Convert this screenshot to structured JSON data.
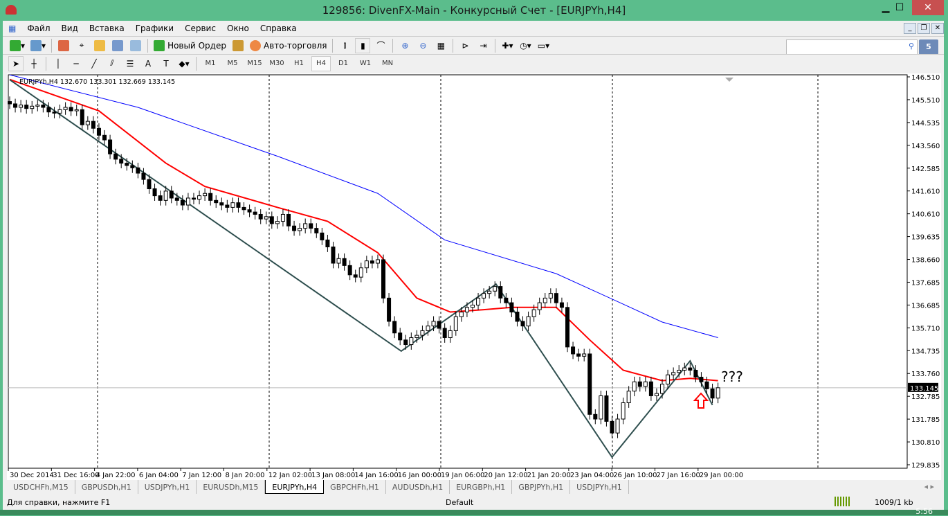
{
  "window": {
    "title": "129856: DivenFX-Main - Конкурсный Счет - [EURJPYh,H4]"
  },
  "menu": [
    "Файл",
    "Вид",
    "Вставка",
    "Графики",
    "Сервис",
    "Окно",
    "Справка"
  ],
  "toolbar": {
    "new_order": "Новый Ордер",
    "auto_trading": "Авто-торговля",
    "messages_count": "5",
    "search_placeholder": ""
  },
  "timeframes": [
    "M1",
    "M5",
    "M15",
    "M30",
    "H1",
    "H4",
    "D1",
    "W1",
    "MN"
  ],
  "active_timeframe": "H4",
  "chart_data": {
    "type": "candlestick",
    "symbol_header": "EURJPYh,H4  132.670 133.301 132.669 133.145",
    "current_price": "133.145",
    "annotation": "???",
    "price_ticks": [
      "146.510",
      "145.510",
      "144.535",
      "143.560",
      "142.585",
      "141.610",
      "140.610",
      "139.635",
      "138.660",
      "137.685",
      "136.685",
      "135.710",
      "134.735",
      "133.760",
      "132.785",
      "131.785",
      "130.810",
      "129.835"
    ],
    "ylim": [
      129.835,
      146.51
    ],
    "time_labels": [
      "30 Dec 2014",
      "31 Dec 16:00",
      "4 Jan 22:00",
      "6 Jan 04:00",
      "7 Jan 12:00",
      "8 Jan 20:00",
      "12 Jan 02:00",
      "13 Jan 08:00",
      "14 Jan 16:00",
      "16 Jan 00:00",
      "19 Jan 06:00",
      "20 Jan 12:00",
      "21 Jan 20:00",
      "23 Jan 04:00",
      "26 Jan 10:00",
      "27 Jan 16:00",
      "29 Jan 00:00"
    ],
    "closes": [
      145.35,
      145.2,
      145.3,
      145.15,
      145.25,
      145.3,
      145.2,
      145.0,
      144.95,
      145.1,
      145.2,
      145.05,
      145.1,
      144.45,
      144.6,
      144.3,
      144.0,
      143.8,
      143.2,
      142.97,
      142.8,
      142.7,
      142.6,
      142.37,
      142.1,
      141.7,
      141.4,
      141.2,
      141.6,
      141.3,
      141.2,
      141.0,
      141.3,
      141.25,
      141.4,
      141.5,
      141.2,
      141.1,
      141.0,
      140.9,
      141.1,
      140.9,
      140.8,
      140.7,
      140.6,
      140.4,
      140.5,
      140.2,
      140.3,
      140.6,
      140.1,
      139.9,
      140.0,
      140.2,
      140.0,
      139.8,
      139.5,
      139.2,
      138.5,
      138.7,
      138.4,
      138.0,
      137.9,
      138.3,
      138.6,
      138.5,
      138.65,
      137.0,
      136.0,
      135.5,
      135.2,
      135.0,
      135.3,
      135.4,
      135.6,
      135.8,
      136.0,
      135.7,
      135.3,
      135.6,
      136.2,
      136.4,
      136.6,
      136.7,
      137.0,
      137.2,
      137.3,
      137.5,
      137.0,
      136.8,
      136.4,
      136.0,
      135.8,
      136.2,
      136.5,
      136.8,
      137.0,
      137.2,
      136.8,
      136.6,
      134.9,
      134.6,
      134.5,
      134.6,
      132.0,
      131.8,
      132.8,
      131.7,
      131.2,
      131.8,
      132.5,
      133.0,
      133.4,
      133.2,
      133.4,
      132.8,
      132.9,
      133.3,
      133.7,
      133.8,
      133.9,
      134.0,
      133.9,
      133.6,
      133.4,
      133.1,
      132.7,
      133.145
    ],
    "ma_red": [
      [
        0,
        146.4
      ],
      [
        16,
        145.05
      ],
      [
        28,
        142.8
      ],
      [
        35,
        141.8
      ],
      [
        48,
        140.9
      ],
      [
        57,
        140.3
      ],
      [
        66,
        138.95
      ],
      [
        73,
        137.0
      ],
      [
        79,
        136.4
      ],
      [
        85,
        136.5
      ],
      [
        90,
        136.6
      ],
      [
        98,
        136.6
      ],
      [
        104,
        135.2
      ],
      [
        110,
        133.9
      ],
      [
        117,
        133.45
      ],
      [
        122,
        133.55
      ],
      [
        127,
        133.45
      ]
    ],
    "ma_blue": [
      [
        0,
        146.6
      ],
      [
        23,
        145.2
      ],
      [
        48,
        143.1
      ],
      [
        66,
        141.5
      ],
      [
        78,
        139.5
      ],
      [
        98,
        138.05
      ],
      [
        109,
        136.85
      ],
      [
        117,
        135.97
      ],
      [
        127,
        135.3
      ]
    ],
    "zigzag": [
      [
        0,
        146.39
      ],
      [
        70.2,
        134.72
      ],
      [
        87.2,
        137.6
      ],
      [
        108,
        130.16
      ],
      [
        122,
        134.3
      ],
      [
        126,
        132.4
      ]
    ],
    "colors": {
      "ma_red": "#ff0000",
      "ma_blue": "#0000ff",
      "zigzag": "#2f4f4f",
      "arrow": "#ff0000"
    }
  },
  "tabs": [
    "USDCHFh,M15",
    "GBPUSDh,H1",
    "USDJPYh,H1",
    "EURUSDh,M15",
    "EURJPYh,H4",
    "GBPCHFh,H1",
    "AUDUSDh,H1",
    "EURGBPh,H1",
    "GBPJPYh,H1",
    "USDJPYh,H1"
  ],
  "active_tab": 4,
  "status": {
    "help": "Для справки, нажмите F1",
    "profile": "Default",
    "traffic": "1009/1 kb"
  },
  "clock": "5:56"
}
